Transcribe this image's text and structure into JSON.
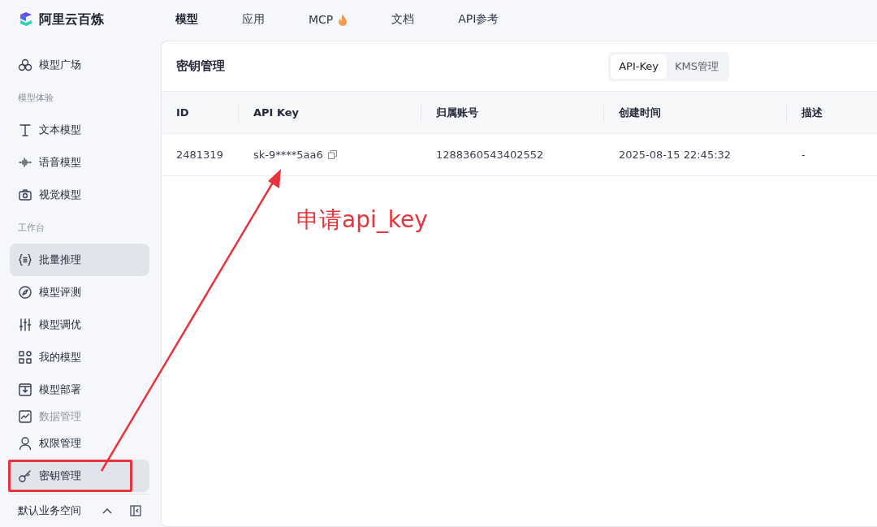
{
  "brand": {
    "name": "阿里云百炼"
  },
  "top_nav": [
    {
      "label": "模型",
      "selected": true,
      "hot": false
    },
    {
      "label": "应用",
      "selected": false,
      "hot": false
    },
    {
      "label": "MCP",
      "selected": false,
      "hot": true
    },
    {
      "label": "文档",
      "selected": false,
      "hot": false
    },
    {
      "label": "API参考",
      "selected": false,
      "hot": false
    }
  ],
  "sidebar": {
    "items": [
      {
        "kind": "item",
        "label": "模型广场",
        "selected": false,
        "disabled": false
      },
      {
        "kind": "section",
        "label": "模型体验"
      },
      {
        "kind": "item",
        "label": "文本模型",
        "selected": false,
        "disabled": false
      },
      {
        "kind": "item",
        "label": "语音模型",
        "selected": false,
        "disabled": false
      },
      {
        "kind": "item",
        "label": "视觉模型",
        "selected": false,
        "disabled": false
      },
      {
        "kind": "section",
        "label": "工作台"
      },
      {
        "kind": "item",
        "label": "批量推理",
        "selected": true,
        "disabled": false
      },
      {
        "kind": "item",
        "label": "模型评测",
        "selected": false,
        "disabled": false
      },
      {
        "kind": "item",
        "label": "模型调优",
        "selected": false,
        "disabled": false
      },
      {
        "kind": "item",
        "label": "我的模型",
        "selected": false,
        "disabled": false
      },
      {
        "kind": "item",
        "label": "模型部署",
        "selected": false,
        "disabled": false
      },
      {
        "kind": "item",
        "label": "数据管理",
        "selected": false,
        "disabled": true
      },
      {
        "kind": "item",
        "label": "权限管理",
        "selected": false,
        "disabled": false
      },
      {
        "kind": "item",
        "label": "密钥管理",
        "selected": true,
        "disabled": false
      }
    ],
    "workspace": "默认业务空间"
  },
  "panel": {
    "title": "密钥管理",
    "tabs": [
      {
        "label": "API-Key",
        "selected": true
      },
      {
        "label": "KMS管理",
        "selected": false
      }
    ],
    "table": {
      "columns": [
        "ID",
        "API Key",
        "归属账号",
        "创建时间",
        "描述"
      ],
      "rows": [
        [
          "2481319",
          "sk-9****5aa6",
          "1288360543402552",
          "2025-08-15 22:45:32",
          "-"
        ]
      ]
    }
  },
  "annotation": {
    "text": "申请api_key"
  }
}
